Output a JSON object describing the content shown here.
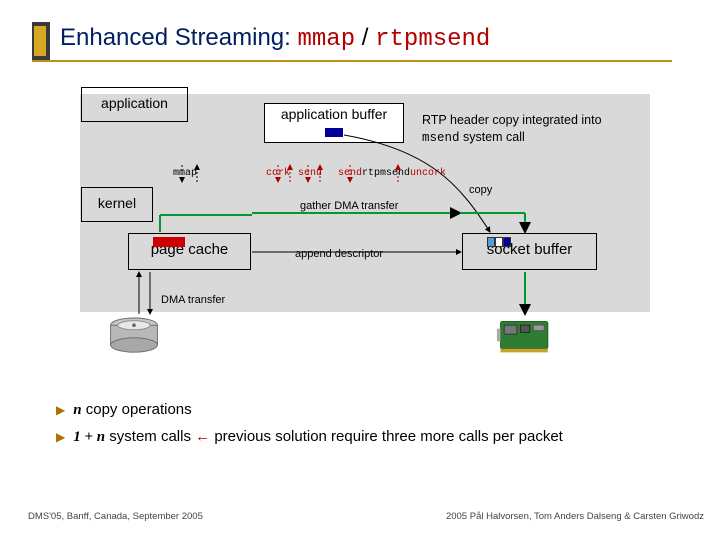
{
  "title": {
    "prefix": "Enhanced Streaming: ",
    "mmap": "mmap",
    "slash": " / ",
    "rtpmsend": "rtpmsend"
  },
  "boxes": {
    "application": "application",
    "app_buffer": "application buffer",
    "kernel": "kernel",
    "page_cache": "page cache",
    "socket_buffer": "socket buffer"
  },
  "labels": {
    "mmap": "mmap",
    "cork": "cork",
    "send": "send",
    "sendrtp": "send",
    "rtpmsend_small": "rtpmsend",
    "uncork": "uncork",
    "gather": "gather DMA transfer",
    "copy": "copy",
    "append": "append descriptor",
    "dma": "DMA transfer"
  },
  "rtp_note": {
    "line1": "RTP header copy integrated into",
    "msend": "msend",
    "line2_suffix": " system call"
  },
  "bullets": {
    "n": "n",
    "copy_ops": " copy operations",
    "one_plus_n": "1 + n",
    "syscalls": " system calls",
    "arrow": "  ←  ",
    "prev": "previous solution require three more calls per packet"
  },
  "footer": {
    "left": "DMS'05, Banff, Canada, September 2005",
    "right": "2005  Pål Halvorsen, Tom Anders Dalseng & Carsten Griwodz"
  }
}
